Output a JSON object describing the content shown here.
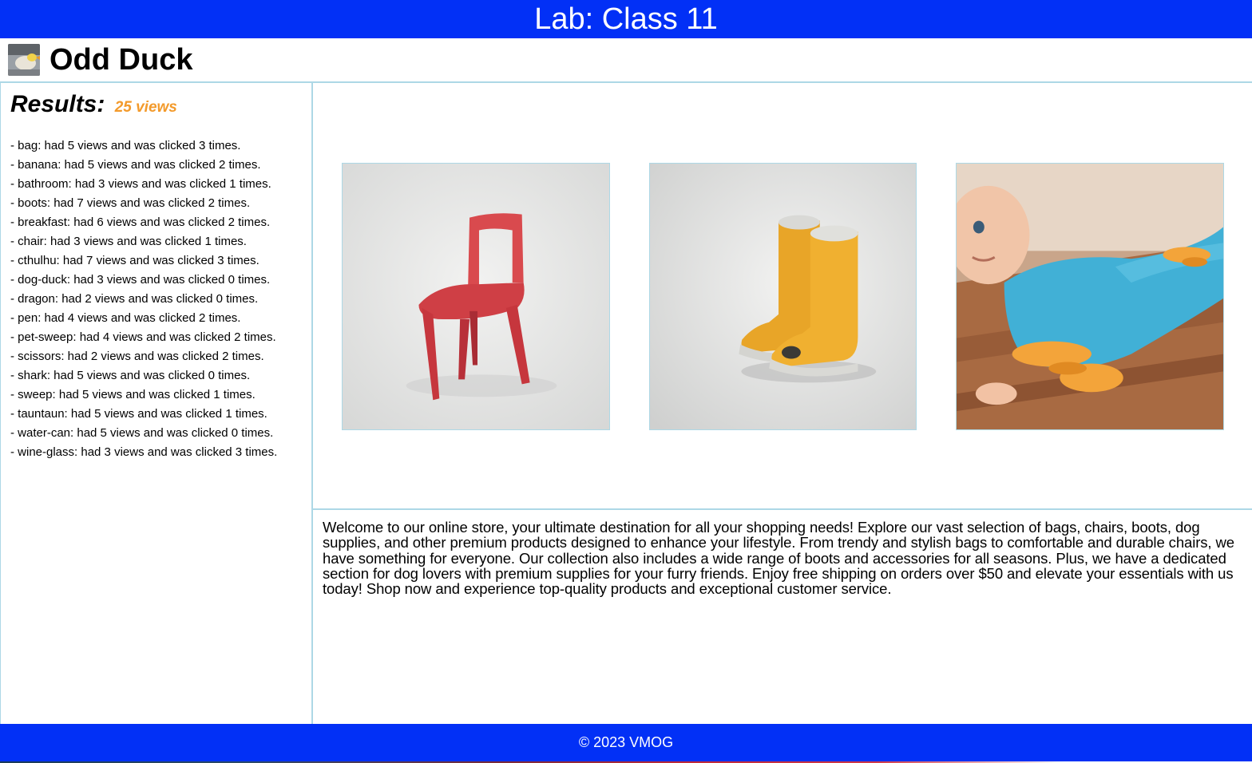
{
  "banner": {
    "title": "Lab: Class 11"
  },
  "header": {
    "logo_icon": "odd-duck-logo-icon",
    "title": "Odd Duck"
  },
  "results": {
    "heading": "Results:",
    "views": "25 views",
    "items": [
      "- bag: had 5 views and was clicked 3 times.",
      "- banana: had 5 views and was clicked 2 times.",
      "- bathroom: had 3 views and was clicked 1 times.",
      "- boots: had 7 views and was clicked 2 times.",
      "- breakfast: had 6 views and was clicked 2 times.",
      "- chair: had 3 views and was clicked 1 times.",
      "- cthulhu: had 7 views and was clicked 3 times.",
      "- dog-duck: had 3 views and was clicked 0 times.",
      "- dragon: had 2 views and was clicked 0 times.",
      "- pen: had 4 views and was clicked 2 times.",
      "- pet-sweep: had 4 views and was clicked 2 times.",
      "- scissors: had 2 views and was clicked 2 times.",
      "- shark: had 5 views and was clicked 0 times.",
      "- sweep: had 5 views and was clicked 1 times.",
      "- tauntaun: had 5 views and was clicked 1 times.",
      "- water-can: had 5 views and was clicked 0 times.",
      "- wine-glass: had 3 views and was clicked 3 times."
    ]
  },
  "products": [
    {
      "name": "chair",
      "icon": "chair-image"
    },
    {
      "name": "boots",
      "icon": "boots-image"
    },
    {
      "name": "sweep",
      "icon": "sweep-baby-image"
    }
  ],
  "description": "Welcome to our online store, your ultimate destination for all your shopping needs! Explore our vast selection of bags, chairs, boots, dog supplies, and other premium products designed to enhance your lifestyle. From trendy and stylish bags to comfortable and durable chairs, we have something for everyone. Our collection also includes a wide range of boots and accessories for all seasons. Plus, we have a dedicated section for dog lovers with premium supplies for your furry friends. Enjoy free shipping on orders over $50 and elevate your essentials with us today! Shop now and experience top-quality products and exceptional customer service.",
  "footer": {
    "text": "© 2023 VMOG"
  },
  "colors": {
    "banner": "#0230f6",
    "border": "#add8e6",
    "views_accent": "#f39a2b"
  }
}
